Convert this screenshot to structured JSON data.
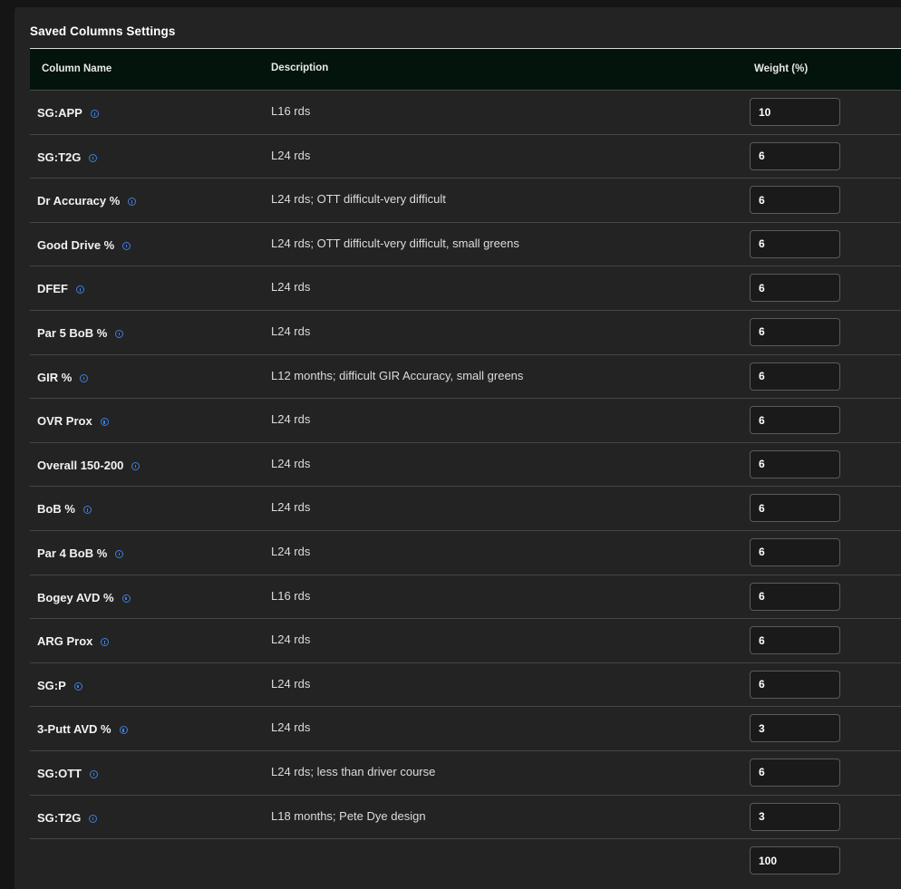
{
  "panel": {
    "title": "Saved Columns Settings"
  },
  "table": {
    "headers": {
      "name": "Column Name",
      "description": "Description",
      "weight": "Weight (%)"
    },
    "rows": [
      {
        "name": "SG:APP",
        "description": "L16 rds",
        "weight": "10"
      },
      {
        "name": "SG:T2G",
        "description": "L24 rds",
        "weight": "6"
      },
      {
        "name": "Dr Accuracy %",
        "description": "L24 rds; OTT difficult-very difficult",
        "weight": "6"
      },
      {
        "name": "Good Drive %",
        "description": "L24 rds; OTT difficult-very difficult, small greens",
        "weight": "6"
      },
      {
        "name": "DFEF",
        "description": "L24 rds",
        "weight": "6"
      },
      {
        "name": "Par 5 BoB %",
        "description": "L24 rds",
        "weight": "6"
      },
      {
        "name": "GIR %",
        "description": "L12 months; difficult GIR Accuracy, small greens",
        "weight": "6"
      },
      {
        "name": "OVR Prox",
        "description": "L24 rds",
        "weight": "6"
      },
      {
        "name": "Overall 150-200",
        "description": "L24 rds",
        "weight": "6"
      },
      {
        "name": "BoB %",
        "description": "L24 rds",
        "weight": "6"
      },
      {
        "name": "Par 4 BoB %",
        "description": "L24 rds",
        "weight": "6"
      },
      {
        "name": "Bogey AVD %",
        "description": "L16 rds",
        "weight": "6"
      },
      {
        "name": "ARG Prox",
        "description": "L24 rds",
        "weight": "6"
      },
      {
        "name": "SG:P",
        "description": "L24 rds",
        "weight": "6"
      },
      {
        "name": "3-Putt AVD %",
        "description": "L24 rds",
        "weight": "3"
      },
      {
        "name": "SG:OTT",
        "description": "L24 rds; less than driver course",
        "weight": "6"
      },
      {
        "name": "SG:T2G",
        "description": "L18 months; Pete Dye design",
        "weight": "3"
      }
    ],
    "total_weight": "100"
  },
  "colors": {
    "panel_bg": "#232323",
    "header_bg": "#03140c",
    "info_icon": "#3d7ee0"
  },
  "icons": {
    "info": "info-icon"
  }
}
